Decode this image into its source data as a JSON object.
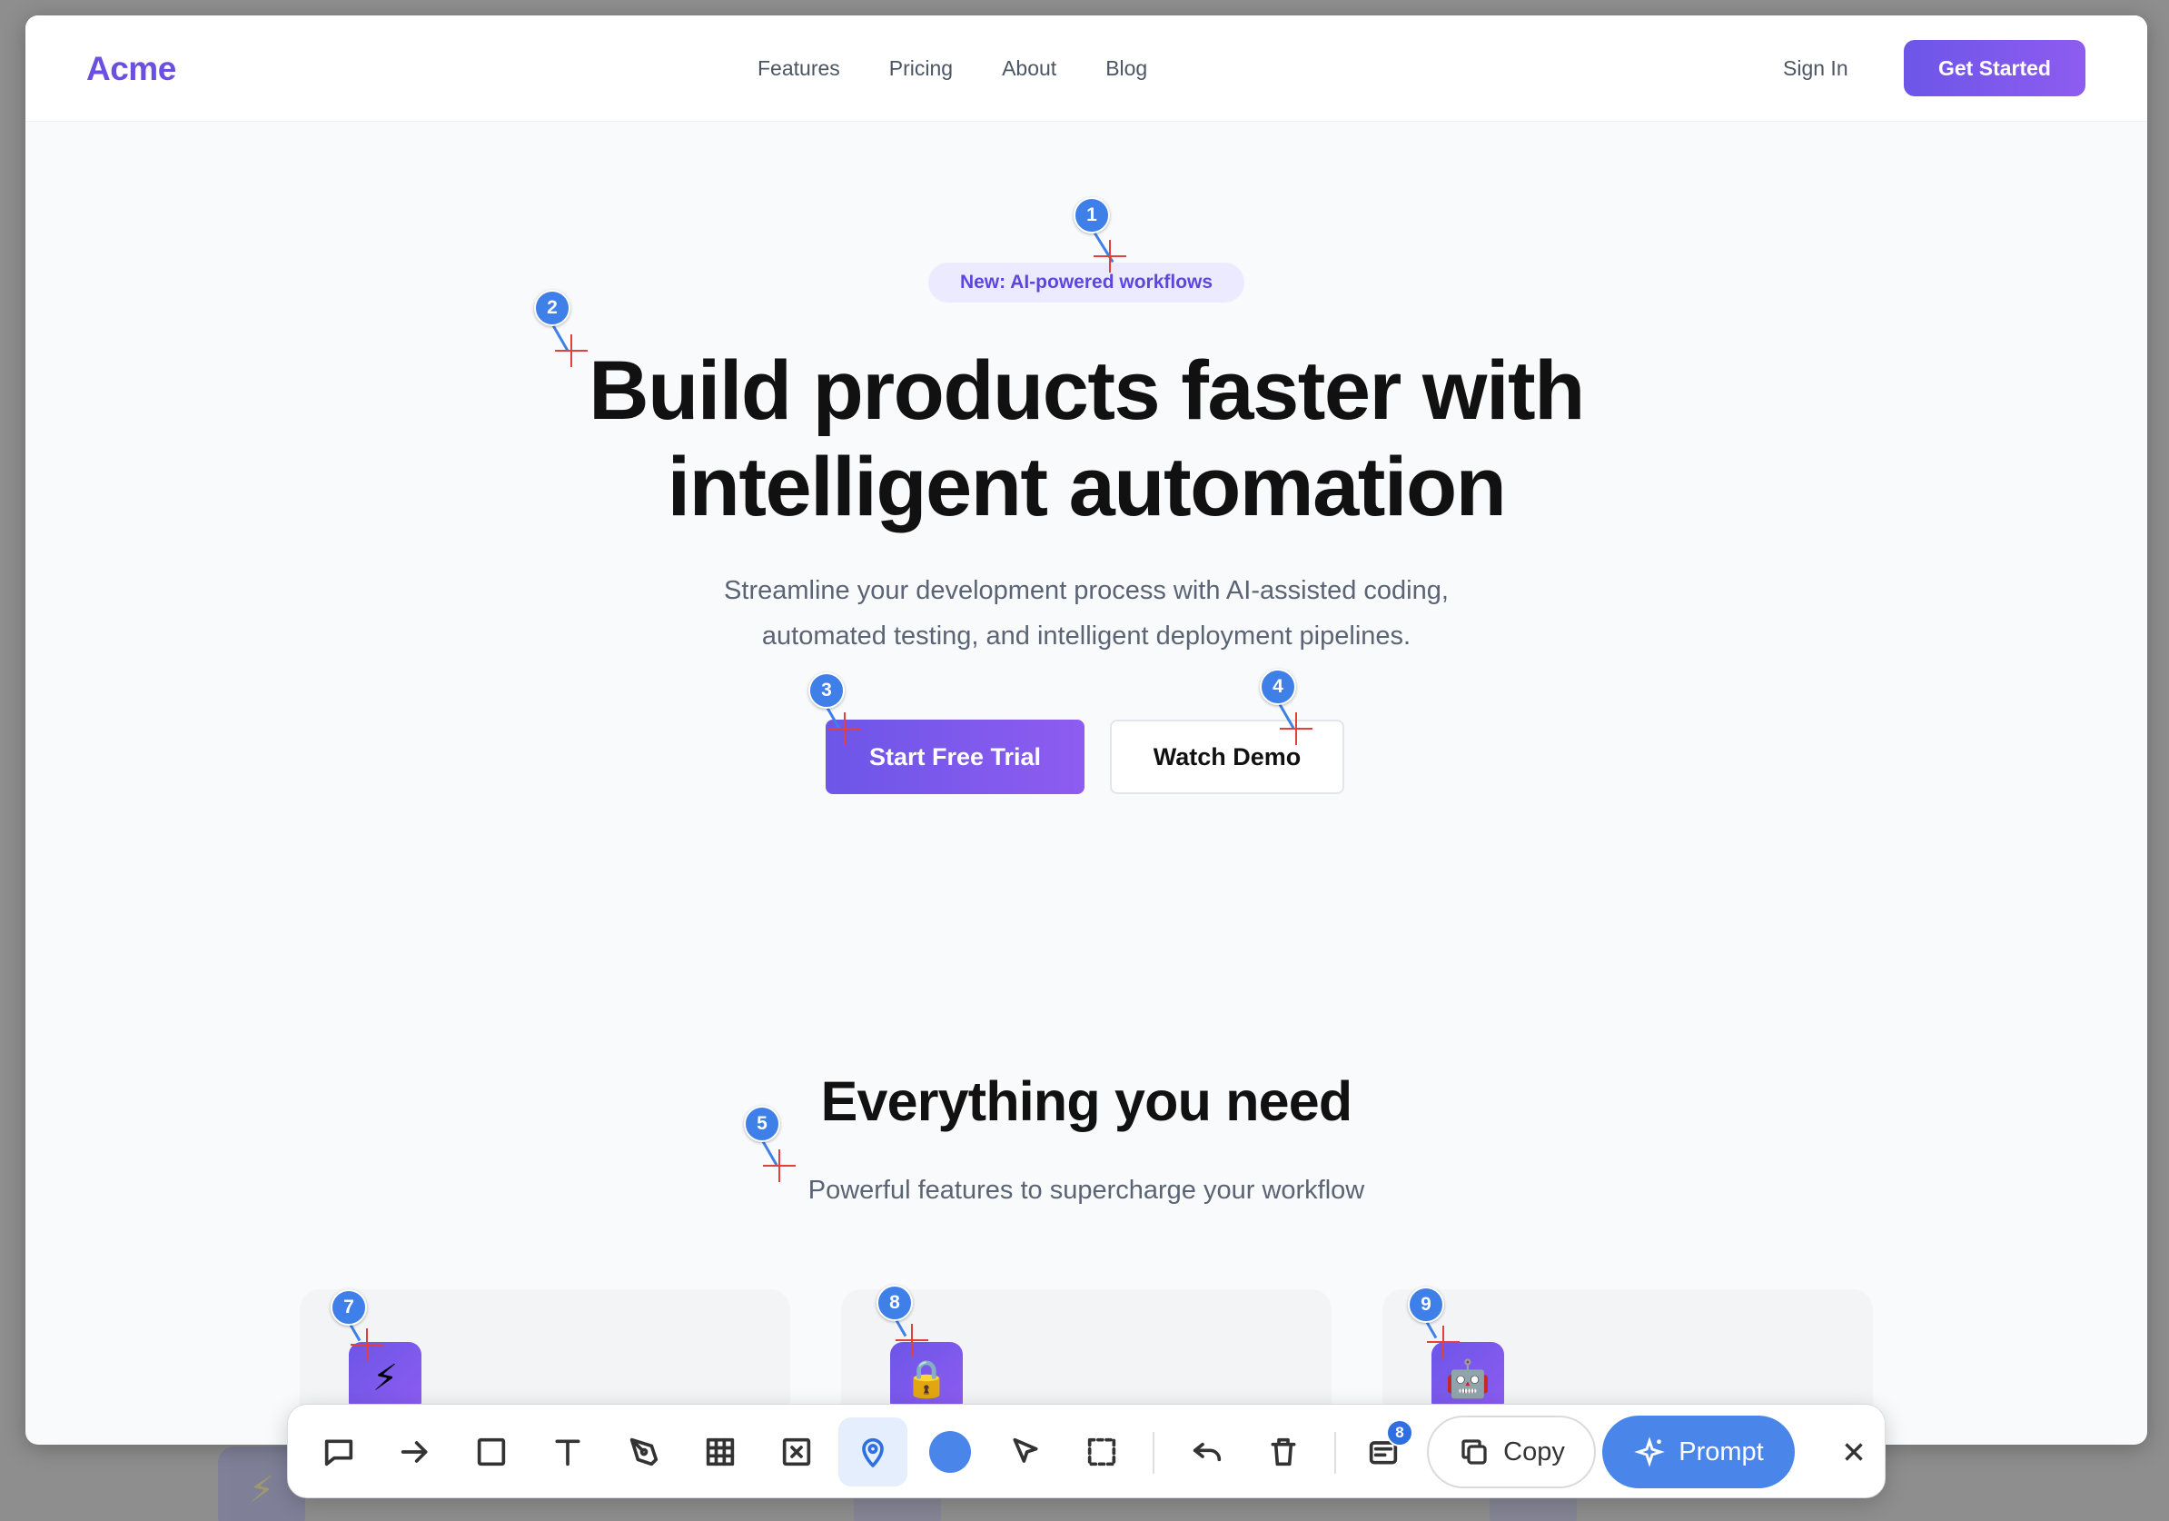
{
  "nav": {
    "logo": "Acme",
    "links": [
      "Features",
      "Pricing",
      "About",
      "Blog"
    ],
    "sign_in": "Sign In",
    "get_started": "Get Started"
  },
  "hero": {
    "badge": "New: AI-powered workflows",
    "headline_line1": "Build products faster with",
    "headline_line2": "intelligent automation",
    "subtitle_line1": "Streamline your development process with AI-assisted coding,",
    "subtitle_line2": "automated testing, and intelligent deployment pipelines.",
    "primary_cta": "Start Free Trial",
    "secondary_cta": "Watch Demo"
  },
  "features": {
    "title": "Everything you need",
    "subtitle": "Powerful features to supercharge your workflow",
    "cards": [
      {
        "icon": "⚡",
        "icon_name": "lightning-icon"
      },
      {
        "icon": "🔒",
        "icon_name": "lock-icon"
      },
      {
        "icon": "🤖",
        "icon_name": "robot-icon"
      }
    ]
  },
  "markers": [
    "1",
    "2",
    "3",
    "4",
    "5",
    "7",
    "8",
    "9"
  ],
  "toolbar": {
    "tools": [
      "comment-icon",
      "arrow-icon",
      "rectangle-icon",
      "text-icon",
      "pen-icon",
      "grid-icon",
      "x-box-icon",
      "pin-icon",
      "color-dot",
      "cursor-icon",
      "selection-icon",
      "undo-icon",
      "trash-icon",
      "layers-icon"
    ],
    "active_tool": "pin-icon",
    "layers_badge": "8",
    "copy_label": "Copy",
    "prompt_label": "Prompt",
    "accent_color": "#4a86ea"
  },
  "colors": {
    "brand": "#6a4fe0",
    "marker": "#3f7fe8",
    "crosshair": "#e0413b"
  }
}
